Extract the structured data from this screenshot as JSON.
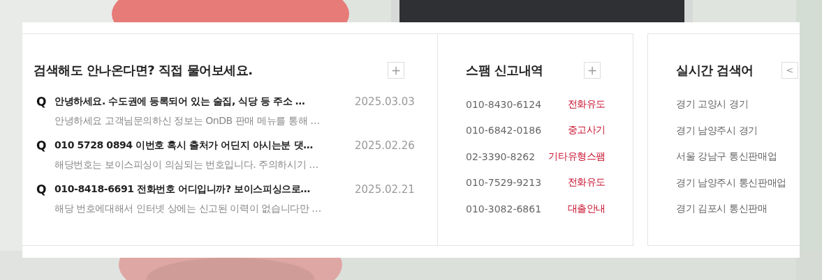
{
  "qna": {
    "title": "검색해도 안나온다면? 직접 물어보세요.",
    "more": "+",
    "items": [
      {
        "marker": "Q",
        "question": "안녕하세요. 수도권에 등록되어 있는 술집, 식당 등 주소 …",
        "date": "2025.03.03",
        "answer": "안녕하세요 고객님문의하신 정보는 OnDB 판매 메뉴를 통해 …"
      },
      {
        "marker": "Q",
        "question": "010 5728 0894 이번호 혹시 출처가 어딘지 아시는분 댓…",
        "date": "2025.02.26",
        "answer": "해당번호는 보이스피싱이 의심되는 번호입니다. 주의하시기 …"
      },
      {
        "marker": "Q",
        "question": "010-8418-6691 전화번호 어디입니까? 보이스피싱으로…",
        "date": "2025.02.21",
        "answer": "해당 번호에대해서 인터넷 상에는 신고된 이력이 없습니다만 …"
      }
    ]
  },
  "spam": {
    "title": "스팸 신고내역",
    "more": "+",
    "items": [
      {
        "number": "010-8430-6124",
        "type": "전화유도"
      },
      {
        "number": "010-6842-0186",
        "type": "중고사기"
      },
      {
        "number": "02-3390-8262",
        "type": "기타유형스팸"
      },
      {
        "number": "010-7529-9213",
        "type": "전화유도"
      },
      {
        "number": "010-3082-6861",
        "type": "대출안내"
      }
    ]
  },
  "trending": {
    "title": "실시간 검색어",
    "prev": "<",
    "items": [
      "경기 고양시 경기",
      "경기 남양주시 경기",
      "서울 강남구 통신판매업",
      "경기 남양주시 통신판매업",
      "경기 김포시 통신판매"
    ]
  }
}
